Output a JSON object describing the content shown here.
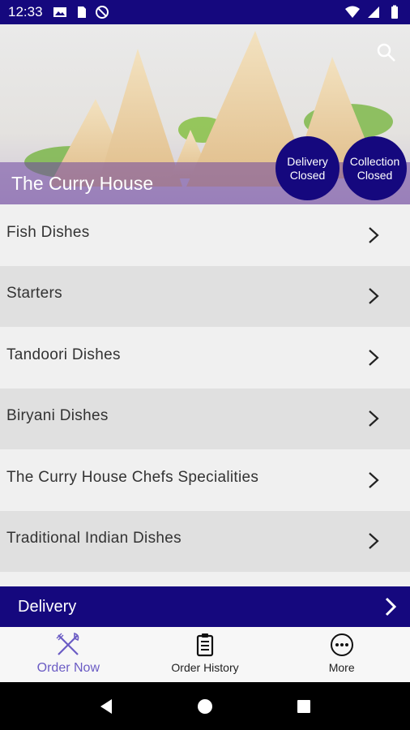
{
  "status_bar": {
    "time": "12:33",
    "icons_left": [
      "image-icon",
      "sim-card-icon",
      "do-not-disturb-icon"
    ],
    "icons_right": [
      "wifi-icon",
      "signal-icon",
      "battery-icon"
    ]
  },
  "header": {
    "restaurant_name": "The Curry House",
    "search_icon": "search-icon",
    "badges": {
      "delivery": "Delivery Closed",
      "collection": "Collection Closed"
    }
  },
  "menu": {
    "items": [
      {
        "label": "Fish Dishes"
      },
      {
        "label": "Starters"
      },
      {
        "label": "Tandoori Dishes"
      },
      {
        "label": "Biryani Dishes"
      },
      {
        "label": "The Curry House Chefs Specialities"
      },
      {
        "label": "Traditional Indian Dishes"
      }
    ]
  },
  "delivery_bar": {
    "label": "Delivery"
  },
  "bottom_nav": {
    "items": [
      {
        "label": "Order Now",
        "icon": "fork-knife-icon",
        "active": true
      },
      {
        "label": "Order History",
        "icon": "clipboard-icon",
        "active": false
      },
      {
        "label": "More",
        "icon": "more-icon",
        "active": false
      }
    ]
  },
  "colors": {
    "primary": "#15087e",
    "active_nav": "#6b5cc4",
    "row_light": "#f0f0f0",
    "row_dark": "#e0e0e0"
  }
}
